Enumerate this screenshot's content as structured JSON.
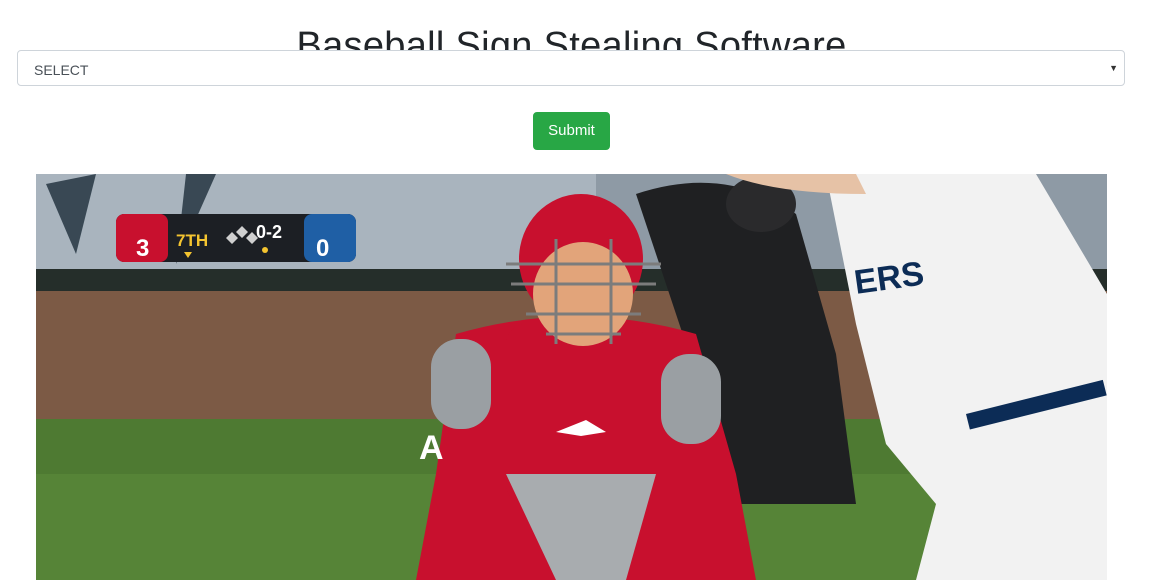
{
  "header": {
    "title": "Baseball Sign Stealing Software"
  },
  "form": {
    "select_value": "SELECT",
    "submit_label": "Submit"
  },
  "video": {
    "scoreboard": {
      "away_score": "3",
      "inning": "7TH",
      "count": "0-2",
      "home_score": "0"
    },
    "jersey_text": "ERS"
  },
  "colors": {
    "submit_green": "#28a745",
    "angels_red": "#c8102e",
    "mariners_navy": "#0c2c56"
  }
}
